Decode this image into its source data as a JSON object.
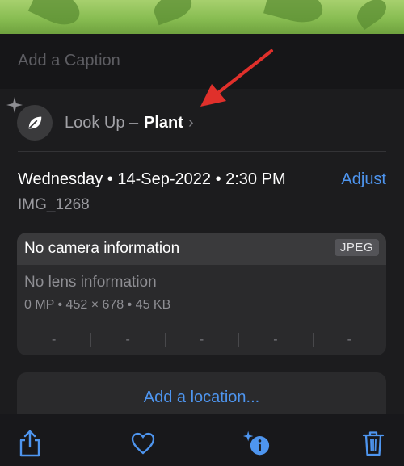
{
  "caption": {
    "placeholder": "Add a Caption"
  },
  "look_up": {
    "label": "Look Up –",
    "value": "Plant",
    "chevron": "›",
    "icon": "leaf-icon"
  },
  "date": {
    "text": "Wednesday • 14-Sep-2022 • 2:30 PM",
    "adjust_label": "Adjust",
    "filename": "IMG_1268"
  },
  "camera": {
    "title": "No camera information",
    "format": "JPEG",
    "lens": "No lens information",
    "specs": "0 MP • 452 × 678 • 45 KB",
    "exif_values": [
      "-",
      "-",
      "-",
      "-",
      "-"
    ]
  },
  "location": {
    "label": "Add a location..."
  },
  "toolbar": {
    "share_icon": "share-icon",
    "favorite_icon": "heart-icon",
    "info_icon": "info-sparkle-icon",
    "delete_icon": "trash-icon"
  },
  "colors": {
    "accent": "#4e95ef",
    "background": "#1c1c1e",
    "annotation_arrow": "#e0302b"
  }
}
